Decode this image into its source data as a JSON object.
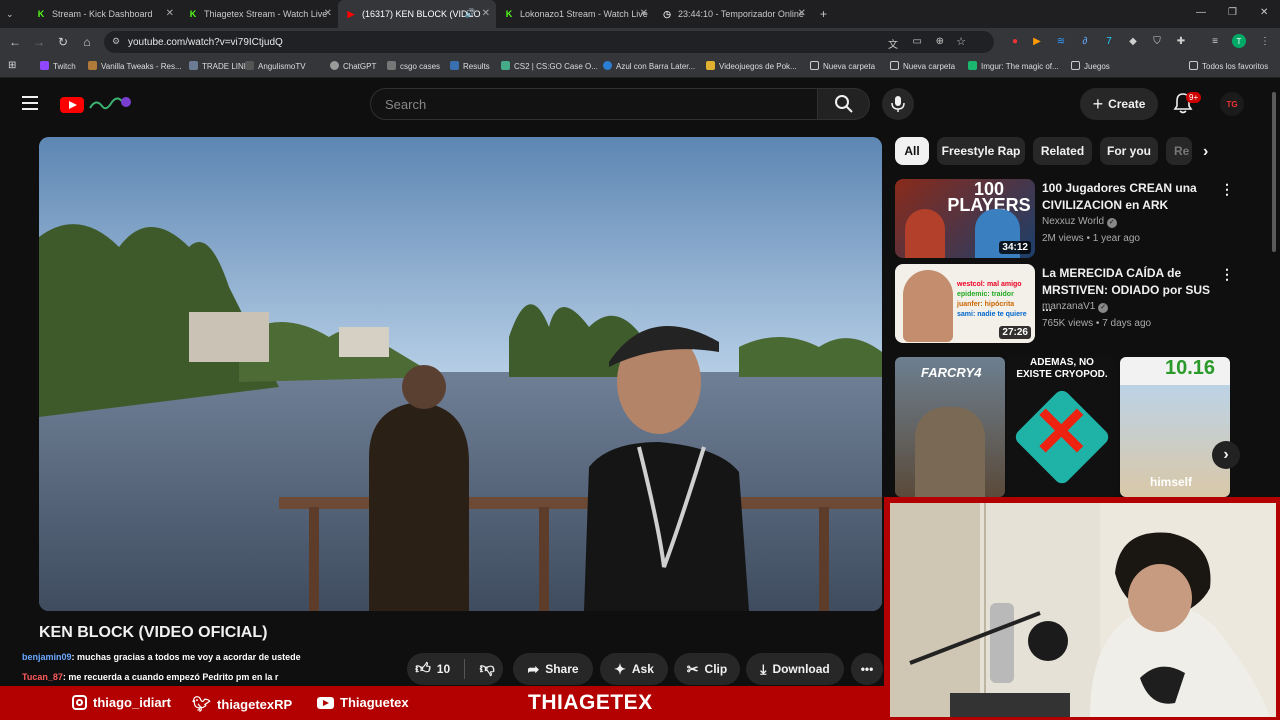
{
  "browser": {
    "tabs": [
      {
        "title": "Stream - Kick Dashboard",
        "favicon": "kick-icon"
      },
      {
        "title": "Thiagetex Stream - Watch Live",
        "favicon": "kick-icon"
      },
      {
        "title": "(16317) KEN BLOCK (VIDEO",
        "favicon": "youtube-icon",
        "active": true
      },
      {
        "title": "Lokonazo1 Stream - Watch Live",
        "favicon": "kick-icon"
      },
      {
        "title": "23:44:10 - Temporizador Online",
        "favicon": "clock-icon"
      }
    ],
    "url": "youtube.com/watch?v=vi79ICtjudQ",
    "bookmarks": [
      "Twitch",
      "Vanilla Tweaks - Res...",
      "TRADE LINK",
      "AngulismoTV",
      "ChatGPT",
      "csgo cases",
      "Results",
      "CS2 | CS:GO Case O...",
      "Azul con Barra Later...",
      "Videojuegos de Pok...",
      "Nueva carpeta",
      "Nueva carpeta",
      "Imgur: The magic of...",
      "Juegos"
    ],
    "all_bookmarks": "Todos los favoritos",
    "profile_initial": "T"
  },
  "youtube": {
    "search_placeholder": "Search",
    "create_label": "Create",
    "notif_count": "9+",
    "avatar_text": "TG",
    "video_title": "KEN BLOCK (VIDEO OFICIAL)",
    "likes": "10",
    "actions": {
      "share": "Share",
      "ask": "Ask",
      "clip": "Clip",
      "download": "Download"
    },
    "chips": [
      "All",
      "Freestyle Rap",
      "Related",
      "For you",
      "Re"
    ],
    "recommendations": [
      {
        "title": "100 Jugadores CREAN una CIVILIZACION en ARK",
        "channel": "Nexxuz World",
        "meta": "2M views • 1 year ago",
        "duration": "34:12",
        "thumb_text": "100 PLAYERS"
      },
      {
        "title": "La MERECIDA CAÍDA de MRSTIVEN: ODIADO por SUS ...",
        "channel": "manzanaV1",
        "meta": "765K views • 7 days ago",
        "duration": "27:26",
        "thumb_lines": [
          "westcol: mal amigo",
          "epidemic: traidor",
          "juanfer: hipócrita",
          "sami: nadie te quiere"
        ]
      }
    ],
    "shorts_text": [
      "FARCRY4",
      "ADEMÁS, NO EXISTE CRYOPOD.",
      "10.16",
      "himself"
    ]
  },
  "overlay": {
    "chat": [
      {
        "user": "benjamin09",
        "text": ": muchas gracias a todos me voy a acordar de ustede"
      },
      {
        "user": "Tucan_87",
        "text": ": me recuerda a cuando empezó Pedrito pm en la r"
      }
    ],
    "socials": [
      {
        "icon": "instagram-icon",
        "handle": "thiago_idiart"
      },
      {
        "icon": "twitter-icon",
        "handle": "thiagetexRP"
      },
      {
        "icon": "youtube-icon",
        "handle": "Thiaguetex"
      }
    ],
    "brand": "THIAGETEX"
  },
  "colors": {
    "kick": "#53fc18",
    "youtube_red": "#ff0000",
    "overlay_red": "#b30000"
  }
}
